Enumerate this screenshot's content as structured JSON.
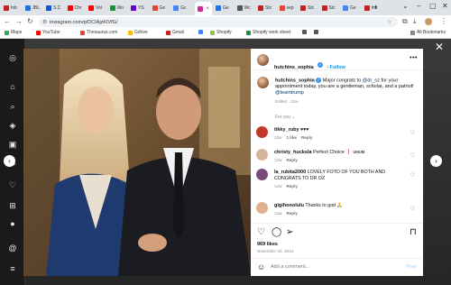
{
  "browser": {
    "tabs": [
      {
        "label": "Inb",
        "color": "#c5221f"
      },
      {
        "label": "JBL",
        "color": "#1a73e8"
      },
      {
        "label": "S.C",
        "color": "#0b57d0"
      },
      {
        "label": "Chr",
        "color": "#ff0000"
      },
      {
        "label": "Vol",
        "color": "#ff0000"
      },
      {
        "label": "Wo",
        "color": "#1e8e3e"
      },
      {
        "label": "YS",
        "color": "#6001d2"
      },
      {
        "label": "Ge",
        "color": "#ea4335"
      },
      {
        "label": "Gc",
        "color": "#4285f4"
      },
      {
        "label": "",
        "color": "#d6249f",
        "active": true
      },
      {
        "label": "Ge",
        "color": "#1a73e8"
      },
      {
        "label": "Wc",
        "color": "#555555"
      },
      {
        "label": "Stc",
        "color": "#c5221f"
      },
      {
        "label": "sep",
        "color": "#ea4335"
      },
      {
        "label": "Stc",
        "color": "#c5221f"
      },
      {
        "label": "Stc",
        "color": "#c5221f"
      },
      {
        "label": "Ge",
        "color": "#4285f4"
      },
      {
        "label": "Inb",
        "color": "#c5221f"
      }
    ],
    "url": "instagram.com/p/DCIAjzKIVfG/",
    "bookmarks": [
      {
        "label": "Maps",
        "color": "#34a853"
      },
      {
        "label": "YouTube",
        "color": "#ff0000"
      },
      {
        "label": "Thesaurus.com",
        "color": "#ea4335"
      },
      {
        "label": "Gdrive",
        "color": "#fbbc04"
      },
      {
        "label": "Gmail",
        "color": "#c5221f"
      },
      {
        "label": "",
        "color": "#4285f4"
      },
      {
        "label": "Shopify",
        "color": "#95bf47"
      },
      {
        "label": "Shopify work sheet",
        "color": "#1e8e3e"
      },
      {
        "label": "",
        "color": "#555555"
      },
      {
        "label": "",
        "color": "#555555"
      }
    ],
    "all_bookmarks": "All Bookmarks"
  },
  "post": {
    "username": "hutchins_sophia",
    "follow_label": "Follow",
    "caption_pre": "Major congrats to ",
    "caption_mention": "@dr_oz",
    "caption_mid": " for your appointment today, you are a gentleman, scholar, and a patriot! ",
    "caption_mention2": "@teamtrump",
    "caption_meta": "Edited · 12w",
    "for_you": "For you",
    "comments": [
      {
        "user": "tikky_ruby",
        "text": "♥♥♥",
        "meta_time": "12w",
        "meta_likes": "1 like",
        "reply": "Reply"
      },
      {
        "user": "christy_hucksla",
        "text": "Perfect Choice ❗ ᴜᴍᴜᴍ",
        "meta_time": "12w",
        "reply": "Reply"
      },
      {
        "user": "la_rubita2000",
        "text": "LOVELY FOTO OF YOU BOTH AND CONGRATS TO DR OZ",
        "meta_time": "12w",
        "reply": "Reply"
      },
      {
        "user": "gigihonolulu",
        "text": "Thanks to god 🙏",
        "meta_time": "12w",
        "reply": "Reply"
      }
    ],
    "likes": "969 likes",
    "date": "November 20, 2024",
    "add_comment_placeholder": "Add a comment...",
    "post_label": "Post"
  }
}
